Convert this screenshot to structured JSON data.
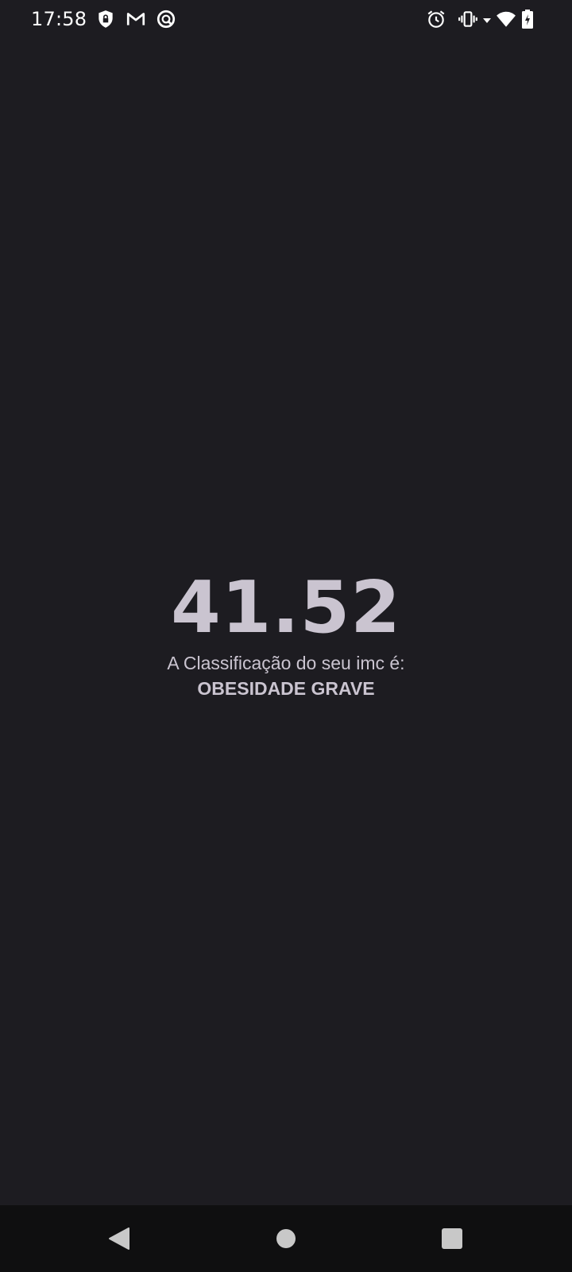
{
  "status_bar": {
    "time": "17:58",
    "left_icons": [
      "vpn-shield-icon",
      "gmail-icon",
      "app-notification-icon"
    ],
    "right_icons": [
      "alarm-icon",
      "vibrate-icon",
      "wifi-icon",
      "battery-charging-icon"
    ]
  },
  "result": {
    "imc_value": "41.52",
    "classification_label": "A Classificação do seu imc é:",
    "classification_value": "OBESIDADE GRAVE"
  },
  "navigation": {
    "buttons": [
      "back-icon",
      "home-icon",
      "recents-icon"
    ]
  },
  "colors": {
    "background": "#1d1c21",
    "text": "#cac4d0",
    "nav_background": "#0f0f10"
  }
}
